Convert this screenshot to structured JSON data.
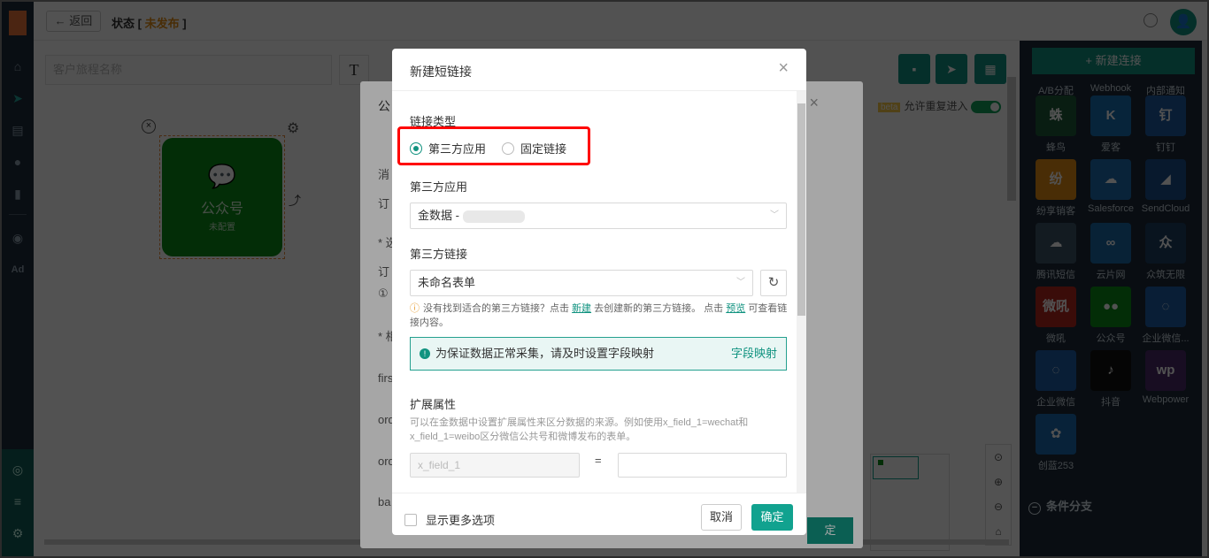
{
  "topbar": {
    "back_label": "返回",
    "status_prefix": "状态 [ ",
    "status_value": "未发布",
    "status_suffix": " ]",
    "avatar_glyph": "👤"
  },
  "canvas": {
    "journey_placeholder": "客户旅程名称",
    "text_tool": "T",
    "node": {
      "title": "公众号",
      "subtitle": "未配置"
    },
    "allow_repeat_beta": "beta",
    "allow_repeat_label": "允许重复进入"
  },
  "right_panel": {
    "new_link_label": "+ 新建连接",
    "items": [
      {
        "label": "A/B分配",
        "color": "#1c2b3a",
        "glyph": ""
      },
      {
        "label": "Webhook",
        "color": "#1c2b3a",
        "glyph": ""
      },
      {
        "label": "内部通知",
        "color": "#1c2b3a",
        "glyph": ""
      },
      {
        "label": "蜂鸟",
        "color": "#1f5a3a",
        "glyph": "蛛"
      },
      {
        "label": "爱客",
        "color": "#1971b5",
        "glyph": "K"
      },
      {
        "label": "钉钉",
        "color": "#1e5aa0",
        "glyph": "钉"
      },
      {
        "label": "纷享销客",
        "color": "#e08a14",
        "glyph": "纷"
      },
      {
        "label": "Salesforce",
        "color": "#1d6fb0",
        "glyph": "☁"
      },
      {
        "label": "SendCloud",
        "color": "#1a4f8a",
        "glyph": "◢"
      },
      {
        "label": "腾讯短信",
        "color": "#3d5568",
        "glyph": "☁"
      },
      {
        "label": "云片网",
        "color": "#1b6aa8",
        "glyph": "∞"
      },
      {
        "label": "众筑无限",
        "color": "#1c3e63",
        "glyph": "众"
      },
      {
        "label": "微吼",
        "color": "#b3261e",
        "glyph": "微吼"
      },
      {
        "label": "公众号",
        "color": "#0a8a16",
        "glyph": "●●"
      },
      {
        "label": "企业微信...",
        "color": "#1d5da6",
        "glyph": "◌"
      },
      {
        "label": "企业微信",
        "color": "#1d5da6",
        "glyph": "◌"
      },
      {
        "label": "抖音",
        "color": "#111111",
        "glyph": "♪"
      },
      {
        "label": "Webpower",
        "color": "#4a2b6b",
        "glyph": "wp"
      },
      {
        "label": "创蓝253",
        "color": "#1b6ab0",
        "glyph": "✿"
      }
    ],
    "section_label": "条件分支"
  },
  "backdrop_modal": {
    "title_fragment": "公",
    "row_labels": [
      "消",
      "订",
      "* 选",
      "订",
      "① ",
      "* 相",
      "firs",
      "ord",
      "ord",
      "ba"
    ],
    "ok_label": "定"
  },
  "modal": {
    "title": "新建短链接",
    "link_type_label": "链接类型",
    "radio_options": [
      "第三方应用",
      "固定链接"
    ],
    "selected_option": "第三方应用",
    "third_app_label": "第三方应用",
    "third_app_value": "金数据 -",
    "third_link_label": "第三方链接",
    "third_link_value": "未命名表单",
    "hint_prefix": "没有找到适合的第三方链接？点击",
    "hint_new": "新建",
    "hint_mid": "去创建新的第三方链接。 点击",
    "hint_preview": "预览",
    "hint_suffix": "可查看链接内容。",
    "alert_text": "为保证数据正常采集，请及时设置字段映射",
    "alert_link": "字段映射",
    "ext_label": "扩展属性",
    "ext_desc": "可以在金数据中设置扩展属性来区分数据的来源。例如使用x_field_1=wechat和x_field_1=weibo区分微信公共号和微博发布的表单。",
    "field_key_placeholder": "x_field_1",
    "field_eq": "=",
    "show_more_label": "显示更多选项",
    "cancel_label": "取消",
    "ok_label": "确定"
  }
}
